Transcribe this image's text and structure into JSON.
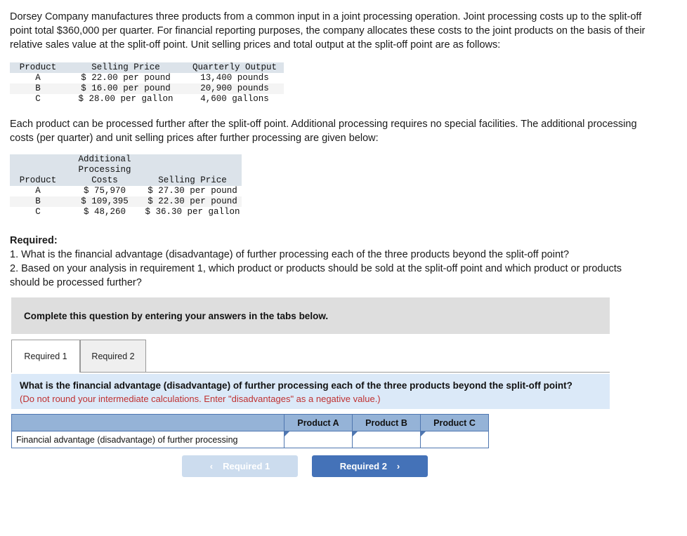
{
  "narrative": {
    "paragraph_1": "Dorsey Company manufactures three products from a common input in a joint processing operation. Joint processing costs up to the split-off point total $360,000 per quarter. For financial reporting purposes, the company allocates these costs to the joint products on the basis of their relative sales value at the split-off point. Unit selling prices and total output at the split-off point are as follows:",
    "paragraph_2": "Each product can be processed further after the split-off point. Additional processing requires no special facilities. The additional processing costs (per quarter) and unit selling prices after further processing are given below:"
  },
  "joint_table": {
    "headers": [
      "Product",
      "Selling Price",
      "Quarterly Output"
    ],
    "rows": [
      {
        "product": "A",
        "selling_price": "$ 22.00 per pound",
        "quarterly_output": "13,400 pounds"
      },
      {
        "product": "B",
        "selling_price": "$ 16.00 per pound",
        "quarterly_output": "20,900 pounds"
      },
      {
        "product": "C",
        "selling_price": "$ 28.00 per gallon",
        "quarterly_output": "4,600 gallons"
      }
    ]
  },
  "further_table": {
    "header_line_1": "Additional",
    "header_line_2": "Processing",
    "headers": [
      "Product",
      "Costs",
      "Selling Price"
    ],
    "rows": [
      {
        "product": "A",
        "cost": "$ 75,970",
        "selling_price": "$ 27.30 per pound"
      },
      {
        "product": "B",
        "cost": "$ 109,395",
        "selling_price": "$ 22.30 per pound"
      },
      {
        "product": "C",
        "cost": "$ 48,260",
        "selling_price": "$ 36.30 per gallon"
      }
    ]
  },
  "required": {
    "heading": "Required:",
    "item_1": "1. What is the financial advantage (disadvantage) of further processing each of the three products beyond the split-off point?",
    "item_2": "2. Based on your analysis in requirement 1, which product or products should be sold at the split-off point and which product or products should be processed further?"
  },
  "banner": {
    "text": "Complete this question by entering your answers in the tabs below."
  },
  "tabs": [
    {
      "label": "Required 1",
      "active": true
    },
    {
      "label": "Required 2",
      "active": false
    }
  ],
  "question_panel": {
    "question": "What is the financial advantage (disadvantage) of further processing each of the three products beyond the split-off point?",
    "note": "(Do not round your intermediate calculations. Enter \"disadvantages\" as a negative value.)"
  },
  "answer_grid": {
    "corner_header": "",
    "column_headers": [
      "Product A",
      "Product B",
      "Product C"
    ],
    "row_label": "Financial advantage (disadvantage) of further processing",
    "values": [
      "",
      "",
      ""
    ]
  },
  "nav": {
    "prev_label": "Required 1",
    "next_label": "Required 2",
    "prev_icon": "chevron-left-icon",
    "next_icon": "chevron-right-icon",
    "prev_chevron": "‹",
    "next_chevron": "›"
  },
  "colors": {
    "banner_grey": "#dedede",
    "panel_blue": "#dbe9f8",
    "note_red": "#bf3030",
    "grid_header_blue": "#95b3d7",
    "grid_border_blue": "#4f76b0",
    "button_active_blue": "#4472b8",
    "button_disabled_blue": "#ccdcee",
    "table_header_grey": "#dce3ea"
  }
}
